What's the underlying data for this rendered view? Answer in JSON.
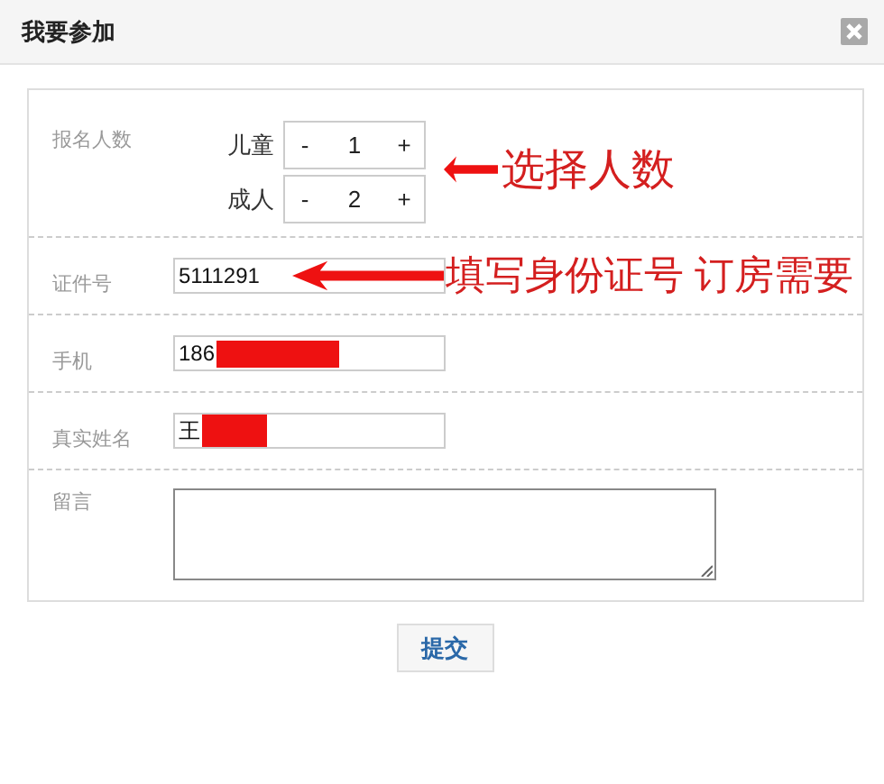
{
  "dialog": {
    "title": "我要参加"
  },
  "people": {
    "label": "报名人数",
    "counters": [
      {
        "label": "儿童",
        "minus": "-",
        "value": "1",
        "plus": "+"
      },
      {
        "label": "成人",
        "minus": "-",
        "value": "2",
        "plus": "+"
      }
    ]
  },
  "fields": [
    {
      "label": "证件号",
      "value": "5111291",
      "redacted": false
    },
    {
      "label": "手机",
      "value": "186",
      "redacted": true
    },
    {
      "label": "真实姓名",
      "value": "王",
      "redacted": true
    }
  ],
  "message": {
    "label": "留言"
  },
  "submit": "提交",
  "annotations": [
    {
      "text": "选择人数"
    },
    {
      "text": "填写身份证号 订房需要"
    }
  ]
}
